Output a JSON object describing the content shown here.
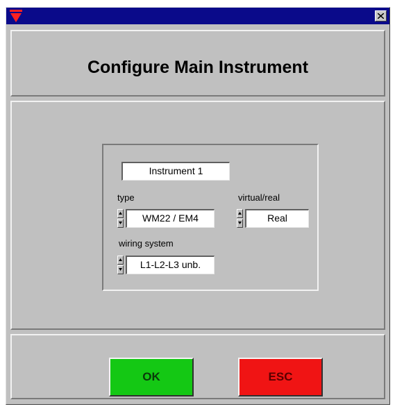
{
  "window": {
    "title_icon": "red-triangle-logo-icon",
    "close_icon": "close-icon",
    "colors": {
      "titlebar": "#0a0a8a",
      "face": "#c0c0c0",
      "ok": "#14c814",
      "esc": "#f01414"
    }
  },
  "dialog": {
    "title": "Configure Main Instrument"
  },
  "instrument": {
    "name": "Instrument  1"
  },
  "fields": {
    "type_label": "type",
    "type_value": "WM22 / EM4",
    "virtual_real_label": "virtual/real",
    "virtual_real_value": "Real",
    "wiring_label": "wiring system",
    "wiring_value": "L1-L2-L3 unb."
  },
  "buttons": {
    "ok": "OK",
    "esc": "ESC"
  }
}
